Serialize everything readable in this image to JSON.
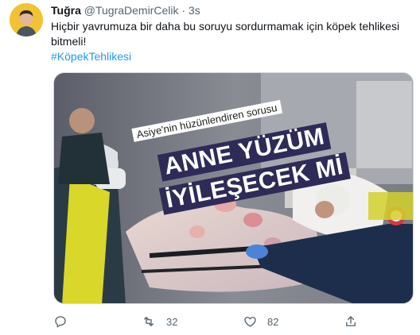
{
  "tweet": {
    "author_name": "Tuğra",
    "author_handle": "@TugraDemirCelik",
    "separator": "·",
    "time": "3s",
    "text": "Hiçbir yavrumuza bir daha bu soruyu sordurmamak için köpek tehlikesi bitmeli!",
    "hashtag": "#KöpekTehlikesi"
  },
  "media": {
    "caption_small": "Asiye'nin hüzünlendiren sorusu",
    "caption_line1": "ANNE YÜZÜM",
    "caption_line2": "İYİLEŞECEK Mİ"
  },
  "actions": {
    "reply_icon": "reply-icon",
    "retweet_icon": "retweet-icon",
    "retweet_count": "32",
    "like_icon": "heart-icon",
    "like_count": "82",
    "share_icon": "share-icon"
  },
  "colors": {
    "accent": "#1d9bf0",
    "secondary_text": "#536471",
    "caption_bg": "#2e2b59"
  }
}
